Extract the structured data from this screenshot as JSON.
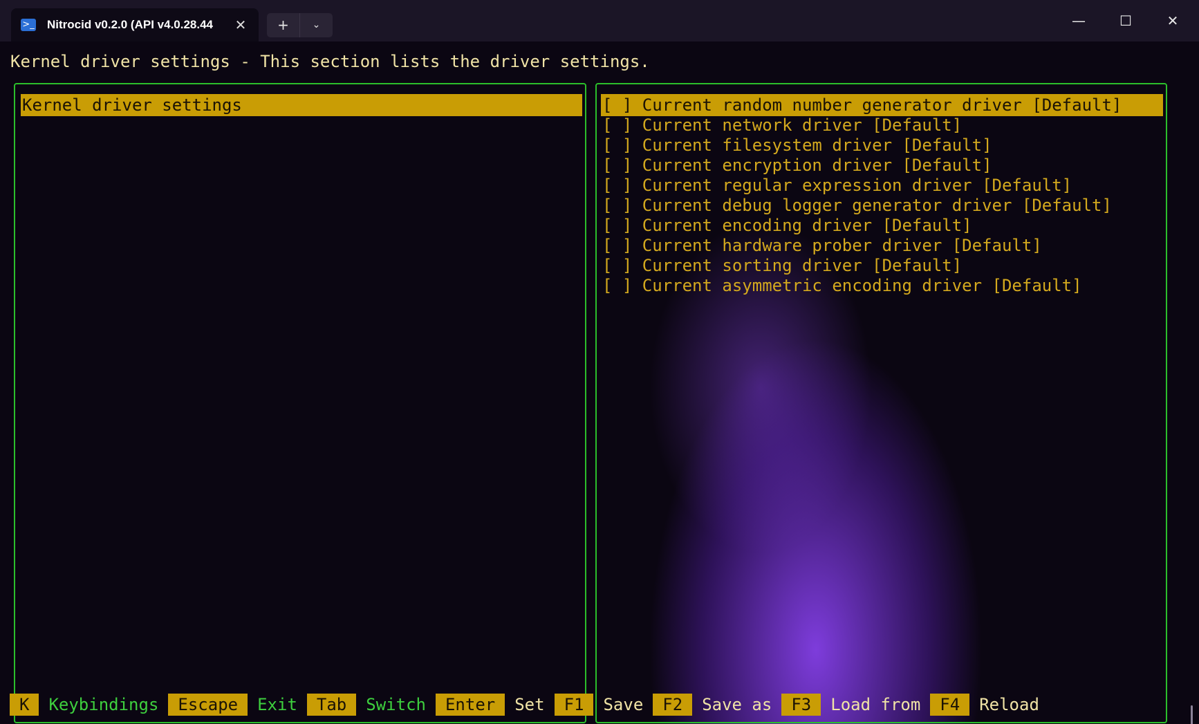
{
  "window": {
    "tab_title": "Nitrocid v0.2.0 (API v4.0.28.44",
    "tab_icon": "powershell-icon",
    "close_tab_icon": "✕",
    "new_tab_icon": "+",
    "dropdown_icon": "⌄",
    "minimize_icon": "—",
    "maximize_icon": "☐",
    "close_icon": "✕"
  },
  "header": {
    "text": "Kernel driver settings - This section lists the driver settings."
  },
  "left_pane": {
    "items": [
      {
        "label": "Kernel driver settings",
        "selected": true
      }
    ]
  },
  "right_pane": {
    "items": [
      {
        "label": "[ ] Current random number generator driver [Default]",
        "selected": true
      },
      {
        "label": "[ ] Current network driver [Default]",
        "selected": false
      },
      {
        "label": "[ ] Current filesystem driver [Default]",
        "selected": false
      },
      {
        "label": "[ ] Current encryption driver [Default]",
        "selected": false
      },
      {
        "label": "[ ] Current regular expression driver [Default]",
        "selected": false
      },
      {
        "label": "[ ] Current debug logger generator driver [Default]",
        "selected": false
      },
      {
        "label": "[ ] Current encoding driver [Default]",
        "selected": false
      },
      {
        "label": "[ ] Current hardware prober driver [Default]",
        "selected": false
      },
      {
        "label": "[ ] Current sorting driver [Default]",
        "selected": false
      },
      {
        "label": "[ ] Current asymmetric encoding driver [Default]",
        "selected": false
      }
    ]
  },
  "keybindings": [
    {
      "key": "K",
      "desc": "Keybindings",
      "color": "green"
    },
    {
      "key": "Escape",
      "desc": "Exit",
      "color": "green"
    },
    {
      "key": "Tab",
      "desc": "Switch",
      "color": "green"
    },
    {
      "key": "Enter",
      "desc": "Set",
      "color": "yellow"
    },
    {
      "key": "F1",
      "desc": "Save",
      "color": "yellow"
    },
    {
      "key": "F2",
      "desc": "Save as",
      "color": "yellow"
    },
    {
      "key": "F3",
      "desc": "Load from",
      "color": "yellow"
    },
    {
      "key": "F4",
      "desc": "Reload",
      "color": "yellow"
    }
  ],
  "colors": {
    "selection": "#c99d05",
    "border": "#2bbf2b",
    "item_text": "#d4a91e",
    "glow": "#9246ff"
  }
}
